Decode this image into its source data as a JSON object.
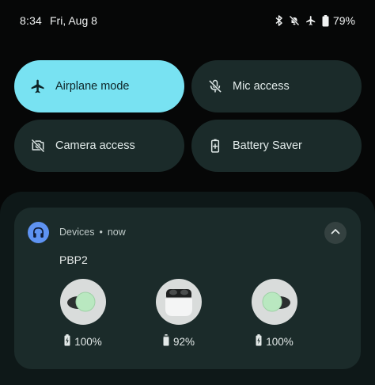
{
  "status_bar": {
    "time": "8:34",
    "date": "Fri, Aug 8",
    "icons": [
      "bluetooth-icon",
      "ring-muted-icon",
      "airplane-icon",
      "battery-icon"
    ],
    "battery_percent": "79%"
  },
  "quick_tiles": [
    {
      "label": "Airplane mode",
      "icon": "airplane-icon",
      "active": true
    },
    {
      "label": "Mic access",
      "icon": "mic-off-icon",
      "active": false
    },
    {
      "label": "Camera access",
      "icon": "camera-off-icon",
      "active": false
    },
    {
      "label": "Battery Saver",
      "icon": "battery-saver-icon",
      "active": false
    }
  ],
  "notification": {
    "app_icon": "headphones-icon",
    "app_name": "Devices",
    "separator": "•",
    "time": "now",
    "title": "PBP2",
    "expand_icon": "chevron-up-icon",
    "devices": [
      {
        "name": "left-earbud",
        "battery": "100%",
        "charging": true,
        "battery_level": 1.0
      },
      {
        "name": "charging-case",
        "battery": "92%",
        "charging": false,
        "battery_level": 0.92
      },
      {
        "name": "right-earbud",
        "battery": "100%",
        "charging": true,
        "battery_level": 1.0
      }
    ]
  },
  "colors": {
    "background": "#060707",
    "tile_inactive": "#1b2b2a",
    "tile_active": "#78e2f2",
    "sheet": "#0e1818",
    "app_icon": "#5e93f2",
    "earbud_green": "#b9e8c0"
  }
}
